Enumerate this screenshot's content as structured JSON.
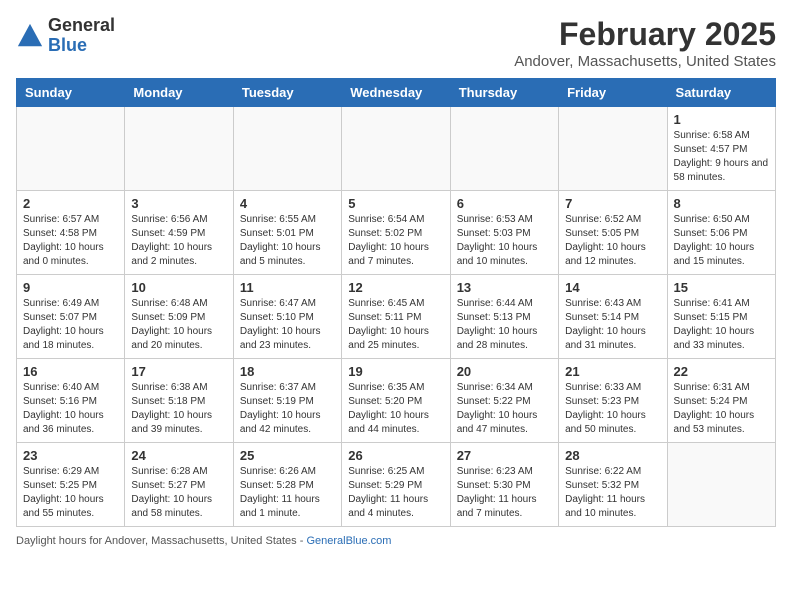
{
  "logo": {
    "general": "General",
    "blue": "Blue"
  },
  "title": "February 2025",
  "subtitle": "Andover, Massachusetts, United States",
  "days_of_week": [
    "Sunday",
    "Monday",
    "Tuesday",
    "Wednesday",
    "Thursday",
    "Friday",
    "Saturday"
  ],
  "footer": {
    "text": "Daylight hours",
    "url_label": "GeneralBlue.com"
  },
  "weeks": [
    {
      "days": [
        {
          "date": "",
          "info": ""
        },
        {
          "date": "",
          "info": ""
        },
        {
          "date": "",
          "info": ""
        },
        {
          "date": "",
          "info": ""
        },
        {
          "date": "",
          "info": ""
        },
        {
          "date": "",
          "info": ""
        },
        {
          "date": "1",
          "info": "Sunrise: 6:58 AM\nSunset: 4:57 PM\nDaylight: 9 hours and 58 minutes."
        }
      ]
    },
    {
      "days": [
        {
          "date": "2",
          "info": "Sunrise: 6:57 AM\nSunset: 4:58 PM\nDaylight: 10 hours and 0 minutes."
        },
        {
          "date": "3",
          "info": "Sunrise: 6:56 AM\nSunset: 4:59 PM\nDaylight: 10 hours and 2 minutes."
        },
        {
          "date": "4",
          "info": "Sunrise: 6:55 AM\nSunset: 5:01 PM\nDaylight: 10 hours and 5 minutes."
        },
        {
          "date": "5",
          "info": "Sunrise: 6:54 AM\nSunset: 5:02 PM\nDaylight: 10 hours and 7 minutes."
        },
        {
          "date": "6",
          "info": "Sunrise: 6:53 AM\nSunset: 5:03 PM\nDaylight: 10 hours and 10 minutes."
        },
        {
          "date": "7",
          "info": "Sunrise: 6:52 AM\nSunset: 5:05 PM\nDaylight: 10 hours and 12 minutes."
        },
        {
          "date": "8",
          "info": "Sunrise: 6:50 AM\nSunset: 5:06 PM\nDaylight: 10 hours and 15 minutes."
        }
      ]
    },
    {
      "days": [
        {
          "date": "9",
          "info": "Sunrise: 6:49 AM\nSunset: 5:07 PM\nDaylight: 10 hours and 18 minutes."
        },
        {
          "date": "10",
          "info": "Sunrise: 6:48 AM\nSunset: 5:09 PM\nDaylight: 10 hours and 20 minutes."
        },
        {
          "date": "11",
          "info": "Sunrise: 6:47 AM\nSunset: 5:10 PM\nDaylight: 10 hours and 23 minutes."
        },
        {
          "date": "12",
          "info": "Sunrise: 6:45 AM\nSunset: 5:11 PM\nDaylight: 10 hours and 25 minutes."
        },
        {
          "date": "13",
          "info": "Sunrise: 6:44 AM\nSunset: 5:13 PM\nDaylight: 10 hours and 28 minutes."
        },
        {
          "date": "14",
          "info": "Sunrise: 6:43 AM\nSunset: 5:14 PM\nDaylight: 10 hours and 31 minutes."
        },
        {
          "date": "15",
          "info": "Sunrise: 6:41 AM\nSunset: 5:15 PM\nDaylight: 10 hours and 33 minutes."
        }
      ]
    },
    {
      "days": [
        {
          "date": "16",
          "info": "Sunrise: 6:40 AM\nSunset: 5:16 PM\nDaylight: 10 hours and 36 minutes."
        },
        {
          "date": "17",
          "info": "Sunrise: 6:38 AM\nSunset: 5:18 PM\nDaylight: 10 hours and 39 minutes."
        },
        {
          "date": "18",
          "info": "Sunrise: 6:37 AM\nSunset: 5:19 PM\nDaylight: 10 hours and 42 minutes."
        },
        {
          "date": "19",
          "info": "Sunrise: 6:35 AM\nSunset: 5:20 PM\nDaylight: 10 hours and 44 minutes."
        },
        {
          "date": "20",
          "info": "Sunrise: 6:34 AM\nSunset: 5:22 PM\nDaylight: 10 hours and 47 minutes."
        },
        {
          "date": "21",
          "info": "Sunrise: 6:33 AM\nSunset: 5:23 PM\nDaylight: 10 hours and 50 minutes."
        },
        {
          "date": "22",
          "info": "Sunrise: 6:31 AM\nSunset: 5:24 PM\nDaylight: 10 hours and 53 minutes."
        }
      ]
    },
    {
      "days": [
        {
          "date": "23",
          "info": "Sunrise: 6:29 AM\nSunset: 5:25 PM\nDaylight: 10 hours and 55 minutes."
        },
        {
          "date": "24",
          "info": "Sunrise: 6:28 AM\nSunset: 5:27 PM\nDaylight: 10 hours and 58 minutes."
        },
        {
          "date": "25",
          "info": "Sunrise: 6:26 AM\nSunset: 5:28 PM\nDaylight: 11 hours and 1 minute."
        },
        {
          "date": "26",
          "info": "Sunrise: 6:25 AM\nSunset: 5:29 PM\nDaylight: 11 hours and 4 minutes."
        },
        {
          "date": "27",
          "info": "Sunrise: 6:23 AM\nSunset: 5:30 PM\nDaylight: 11 hours and 7 minutes."
        },
        {
          "date": "28",
          "info": "Sunrise: 6:22 AM\nSunset: 5:32 PM\nDaylight: 11 hours and 10 minutes."
        },
        {
          "date": "",
          "info": ""
        }
      ]
    }
  ]
}
